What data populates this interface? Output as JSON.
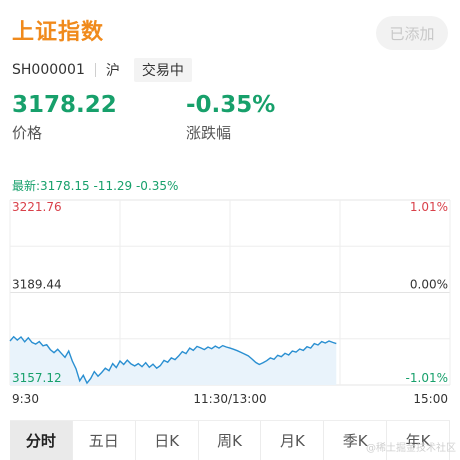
{
  "header": {
    "title": "上证指数",
    "added_label": "已添加"
  },
  "meta": {
    "code": "SH000001",
    "exchange": "沪",
    "status": "交易中"
  },
  "quote": {
    "price": "3178.22",
    "price_label": "价格",
    "change_pct": "-0.35%",
    "change_pct_label": "涨跌幅"
  },
  "latest_line": "最新:3178.15 -11.29 -0.35%",
  "colors": {
    "up": "#d9414a",
    "down": "#17a06b",
    "line": "#2a8fd1",
    "fill": "#e9f3fb",
    "accent": "#f08a1c"
  },
  "chart_data": {
    "type": "area",
    "y_left_labels": [
      "3221.76",
      "3189.44",
      "3157.12"
    ],
    "y_right_labels": [
      "1.01%",
      "0.00%",
      "-1.01%"
    ],
    "x_labels": [
      "9:30",
      "11:30/13:00",
      "15:00"
    ],
    "ylim": [
      3157.12,
      3221.76
    ],
    "reference": 3189.44,
    "x": [
      0,
      2,
      4,
      6,
      8,
      10,
      12,
      14,
      16,
      18,
      20,
      22,
      24,
      26,
      28,
      30,
      32,
      34,
      36,
      38,
      40,
      42,
      44,
      46,
      48,
      50,
      52,
      54,
      56,
      58,
      60,
      62,
      64,
      66,
      68,
      70,
      72,
      74,
      76,
      78,
      80,
      82,
      84,
      86,
      88,
      90,
      92,
      94,
      96,
      98,
      100,
      102,
      104,
      106,
      108,
      110,
      112,
      114,
      116,
      118,
      120,
      122,
      124,
      126,
      128,
      130,
      132,
      134,
      136,
      138,
      140,
      142,
      144,
      146,
      148,
      150,
      152,
      154,
      156,
      158,
      160,
      162,
      164,
      166,
      168,
      170,
      172,
      174,
      176,
      178
    ],
    "values": [
      3172.5,
      3174.0,
      3172.8,
      3173.9,
      3172.2,
      3173.6,
      3172.0,
      3171.4,
      3172.3,
      3170.8,
      3171.2,
      3169.5,
      3168.4,
      3169.6,
      3168.2,
      3166.8,
      3169.0,
      3165.5,
      3162.8,
      3158.6,
      3160.5,
      3157.8,
      3159.4,
      3161.8,
      3160.2,
      3161.5,
      3163.0,
      3162.1,
      3164.6,
      3163.2,
      3165.5,
      3164.3,
      3165.8,
      3164.5,
      3163.8,
      3164.6,
      3163.5,
      3164.9,
      3163.3,
      3164.4,
      3163.0,
      3163.9,
      3165.7,
      3165.1,
      3166.6,
      3166.0,
      3167.3,
      3168.8,
      3168.1,
      3170.0,
      3169.2,
      3170.6,
      3170.1,
      3169.5,
      3170.4,
      3169.8,
      3170.7,
      3170.0,
      3170.9,
      3170.4,
      3170.0,
      3169.6,
      3169.1,
      3168.5,
      3167.9,
      3167.3,
      3166.2,
      3165.0,
      3164.3,
      3164.9,
      3165.6,
      3166.6,
      3166.1,
      3167.5,
      3167.0,
      3168.2,
      3167.6,
      3169.0,
      3168.6,
      3169.7,
      3169.2,
      3170.5,
      3170.0,
      3171.6,
      3171.1,
      3172.3,
      3171.8,
      3172.5,
      3172.0,
      3171.6
    ]
  },
  "tabs": [
    "分时",
    "五日",
    "日K",
    "周K",
    "月K",
    "季K",
    "年K"
  ],
  "active_tab": 0,
  "watermark": "@稀土掘金技术社区"
}
